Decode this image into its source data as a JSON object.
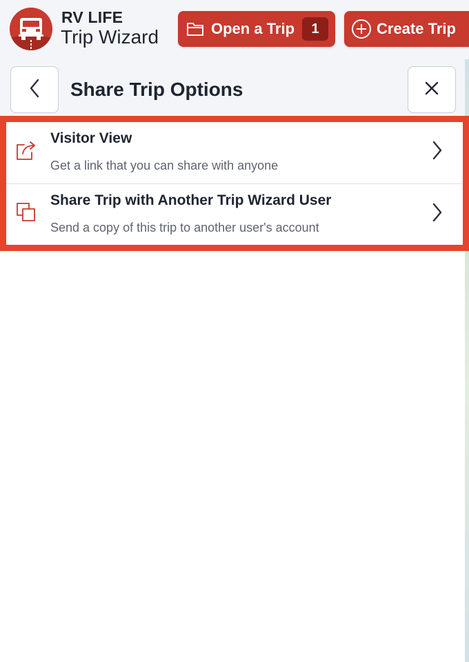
{
  "brand": {
    "line1": "RV LIFE",
    "line2": "Trip Wizard",
    "logo_icon": "rv-logo-icon",
    "color": "#c8392e"
  },
  "header": {
    "open_trip": {
      "label": "Open a Trip",
      "icon": "folder-icon",
      "count": "1"
    },
    "create_trip": {
      "label": "Create Trip",
      "icon": "plus-circle-icon"
    }
  },
  "panel": {
    "title": "Share Trip Options",
    "back_icon": "chevron-left-icon",
    "close_icon": "close-icon",
    "highlight_color": "#e8432c",
    "options": [
      {
        "title": "Visitor View",
        "description": "Get a link that you can share with anyone",
        "icon": "share-icon"
      },
      {
        "title": "Share Trip with Another Trip Wizard User",
        "description": "Send a copy of this trip to another user's account",
        "icon": "copy-icon"
      }
    ]
  }
}
